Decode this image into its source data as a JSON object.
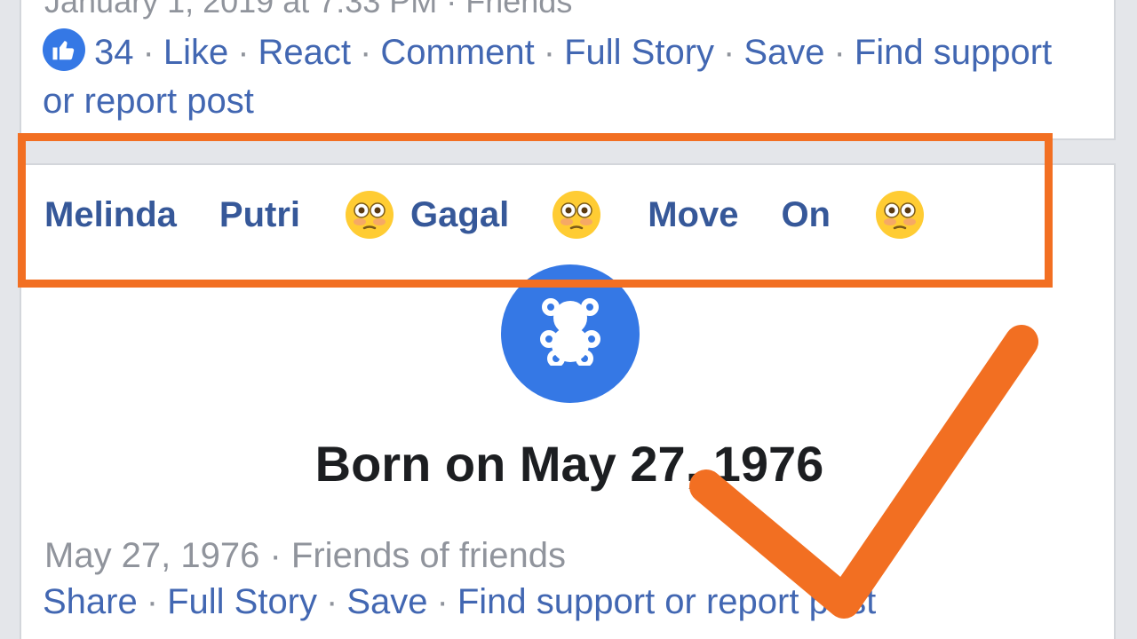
{
  "top_post": {
    "meta": "January 1, 2019 at 7:33 PM · Friends",
    "like_count": "34",
    "actions": [
      "Like",
      "React",
      "Comment",
      "Full Story",
      "Save",
      "Find support or report post"
    ],
    "separator": "·"
  },
  "name_row": {
    "words": [
      "Melinda",
      "Putri",
      "Gagal",
      "Move",
      "On"
    ],
    "emoji_name": "flushed-face-emoji"
  },
  "life_event": {
    "icon_name": "teddy-bear-icon",
    "title": "Born on May 27, 1976",
    "meta": "May 27, 1976 · Friends of friends",
    "actions": [
      "Share",
      "Full Story",
      "Save",
      "Find support or report post"
    ],
    "separator": "·"
  },
  "colors": {
    "link": "#4267b2",
    "name": "#365899",
    "muted": "#90949c",
    "brand_blue": "#3578e5",
    "annotation_orange": "#f26f22"
  }
}
